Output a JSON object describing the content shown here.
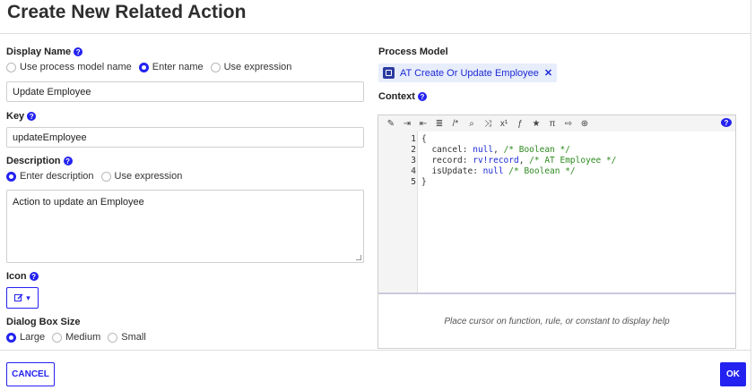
{
  "dialog": {
    "title": "Create New Related Action"
  },
  "display_name": {
    "label": "Display Name",
    "options": [
      "Use process model name",
      "Enter name",
      "Use expression"
    ],
    "selected": "Enter name",
    "value": "Update Employee"
  },
  "key": {
    "label": "Key",
    "value": "updateEmployee"
  },
  "description": {
    "label": "Description",
    "options": [
      "Enter description",
      "Use expression"
    ],
    "selected": "Enter description",
    "value": "Action to update an Employee"
  },
  "icon": {
    "label": "Icon",
    "icon_name": "edit-square-icon"
  },
  "dialog_size": {
    "label": "Dialog Box Size",
    "options": [
      "Large",
      "Medium",
      "Small"
    ],
    "selected": "Large"
  },
  "process_model": {
    "label": "Process Model",
    "value": "AT Create Or Update Employee"
  },
  "context": {
    "label": "Context",
    "line_numbers": [
      "1",
      "2",
      "3",
      "4",
      "5"
    ],
    "lines": [
      {
        "text": "{"
      },
      {
        "key": "cancel: ",
        "value": "null",
        "sep": ", ",
        "comment": "/* Boolean */"
      },
      {
        "key": "record: ",
        "value": "rv!record",
        "sep": ", ",
        "comment": "/* AT Employee */"
      },
      {
        "key": "isUpdate: ",
        "value": "null",
        "sep": " ",
        "comment": "/* Boolean */"
      },
      {
        "text": "}"
      }
    ],
    "help_text": "Place cursor on function, rule, or constant to display help"
  },
  "footer": {
    "cancel_label": "CANCEL",
    "ok_label": "OK"
  },
  "colors": {
    "accent": "#2322f0",
    "comment": "#2d8a1e",
    "chip_bg": "#e7edfb"
  }
}
